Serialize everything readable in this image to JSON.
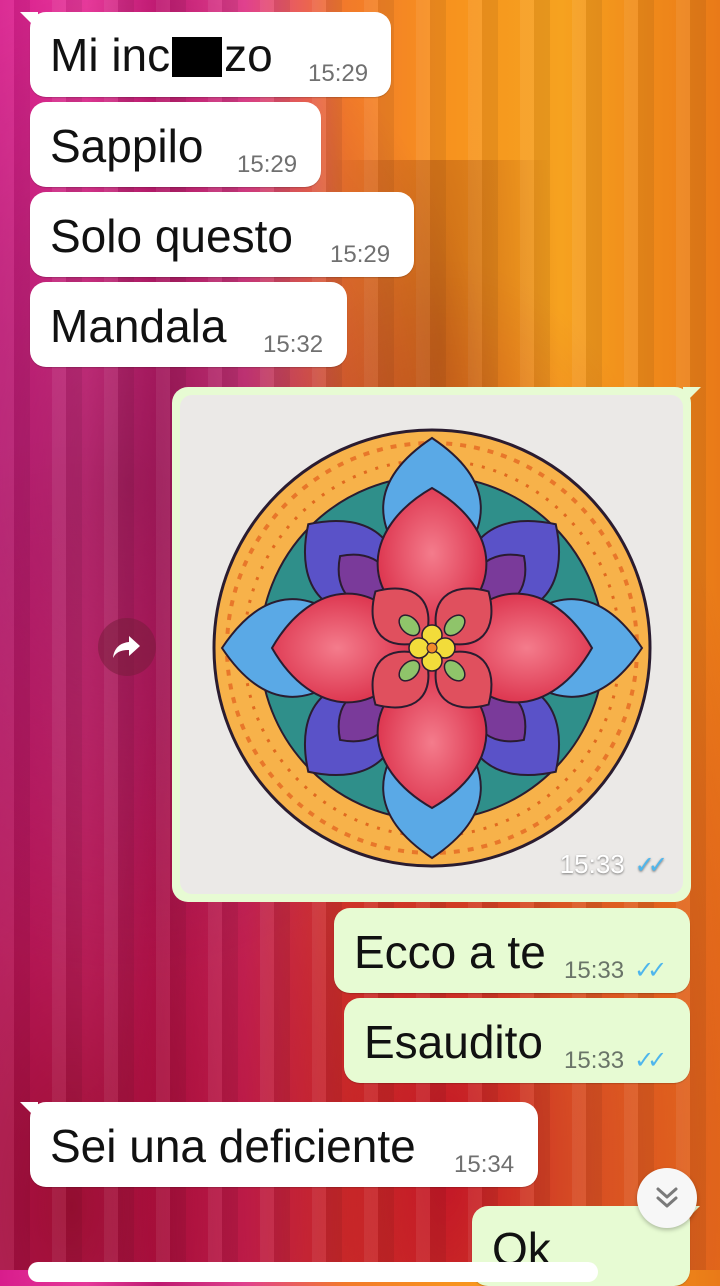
{
  "messages": [
    {
      "pre": "Mi inc",
      "post": "zo",
      "time": "15:29"
    },
    {
      "text": "Sappilo",
      "time": "15:29"
    },
    {
      "text": "Solo questo",
      "time": "15:29"
    },
    {
      "text": "Mandala",
      "time": "15:32"
    }
  ],
  "image_message": {
    "time": "15:33"
  },
  "sent": [
    {
      "text": "Ecco a te",
      "time": "15:33"
    },
    {
      "text": "Esaudito",
      "time": "15:33"
    }
  ],
  "incoming_last": {
    "text": "Sei una deficiente",
    "time": "15:34"
  },
  "partial_sent": {
    "text": "Ok"
  },
  "icons": {
    "forward": "forward-arrow-icon",
    "scroll_down": "double-chevron-down-icon",
    "read_receipt": "double-check-icon"
  },
  "colors": {
    "incoming_bubble": "#ffffff",
    "outgoing_bubble": "#e7fbd3",
    "read_tick": "#4fb6ec"
  }
}
